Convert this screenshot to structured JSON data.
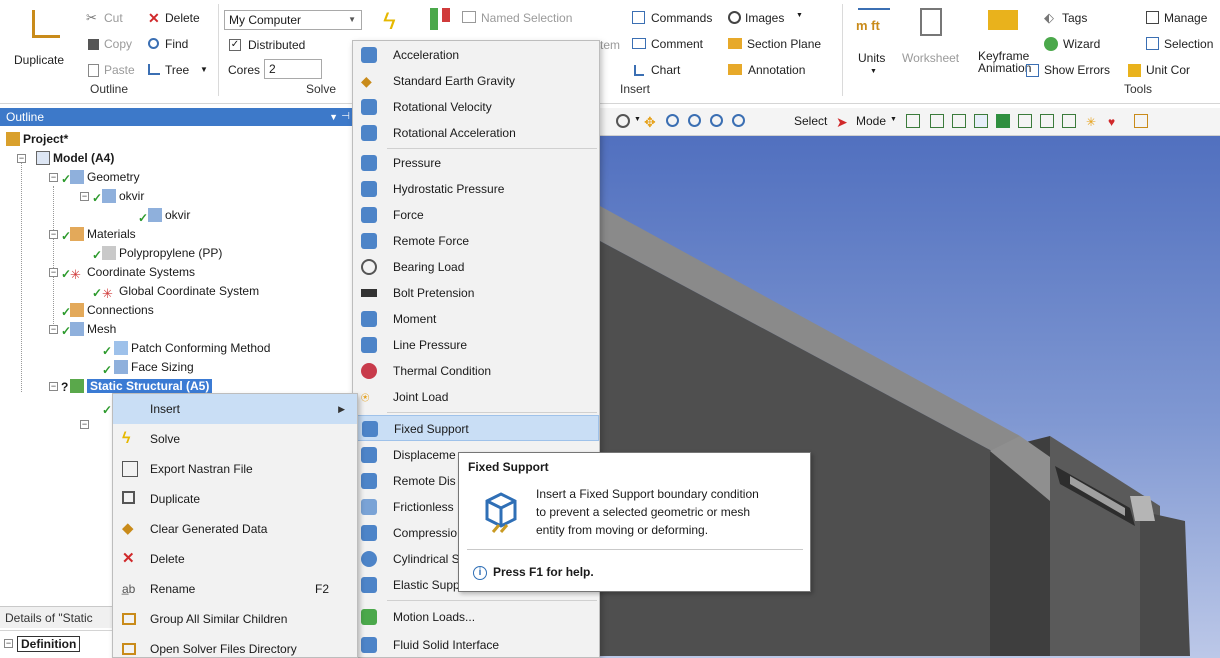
{
  "ribbon": {
    "duplicate": "Duplicate",
    "cut": "Cut",
    "copy": "Copy",
    "paste": "Paste",
    "delete": "Delete",
    "find": "Find",
    "tree": "Tree",
    "outline_group": "Outline",
    "computer_select": "My Computer",
    "distributed": "Distributed",
    "cores_label": "Cores",
    "cores_value": "2",
    "solve_group": "Solve",
    "named_selection": "Named Selection",
    "commands": "Commands",
    "images": "Images",
    "comment": "Comment",
    "section_plane": "Section Plane",
    "chart": "Chart",
    "annotation": "Annotation",
    "system_partial": "tem",
    "insert_group": "Insert",
    "units": "Units",
    "worksheet": "Worksheet",
    "keyframe_1": "Keyframe",
    "keyframe_2": "Animation",
    "tags": "Tags",
    "wizard": "Wizard",
    "show_errors": "Show Errors",
    "manage": "Manage",
    "selection": "Selection",
    "unit_con": "Unit Cor",
    "tools_group": "Tools",
    "mft": "m ft"
  },
  "outline": {
    "title": "Outline",
    "nodes": {
      "project": "Project*",
      "model": "Model (A4)",
      "geometry": "Geometry",
      "okvir_part": "okvir",
      "okvir_body": "okvir",
      "materials": "Materials",
      "polypropylene": "Polypropylene (PP)",
      "coord_systems": "Coordinate Systems",
      "global_cs": "Global Coordinate System",
      "connections": "Connections",
      "mesh": "Mesh",
      "patch_method": "Patch Conforming Method",
      "face_sizing": "Face Sizing",
      "static_structural": "Static Structural (A5)"
    }
  },
  "details": {
    "title": "Details of \"Static",
    "definition": "Definition"
  },
  "graphics_toolbar": {
    "select": "Select",
    "mode": "Mode"
  },
  "context_menu": {
    "items": [
      {
        "label": "Insert"
      },
      {
        "label": "Solve"
      },
      {
        "label": "Export Nastran File"
      },
      {
        "label": "Duplicate"
      },
      {
        "label": "Clear Generated Data"
      },
      {
        "label": "Delete"
      },
      {
        "label": "Rename",
        "shortcut": "F2"
      },
      {
        "label": "Group All Similar Children"
      },
      {
        "label": "Open Solver Files Directory"
      }
    ]
  },
  "insert_submenu": {
    "items": [
      "Acceleration",
      "Standard Earth Gravity",
      "Rotational Velocity",
      "Rotational Acceleration",
      "Pressure",
      "Hydrostatic Pressure",
      "Force",
      "Remote Force",
      "Bearing Load",
      "Bolt Pretension",
      "Moment",
      "Line Pressure",
      "Thermal Condition",
      "Joint Load",
      "Fixed Support",
      "Displaceme",
      "Remote Dis",
      "Frictionless",
      "Compressio",
      "Cylindrical S",
      "Elastic Supp",
      "Motion Loads...",
      "Fluid Solid Interface"
    ]
  },
  "tooltip": {
    "title": "Fixed Support",
    "body_1": "Insert a Fixed Support boundary condition",
    "body_2": "to prevent a selected geometric or mesh",
    "body_3": "entity from moving or deforming.",
    "help": "Press F1 for help."
  },
  "colors": {
    "accent": "#3d79c9",
    "menu_hover": "#c9def5",
    "check_green": "#2c9a2c",
    "graphics_top": "#5170bf"
  }
}
